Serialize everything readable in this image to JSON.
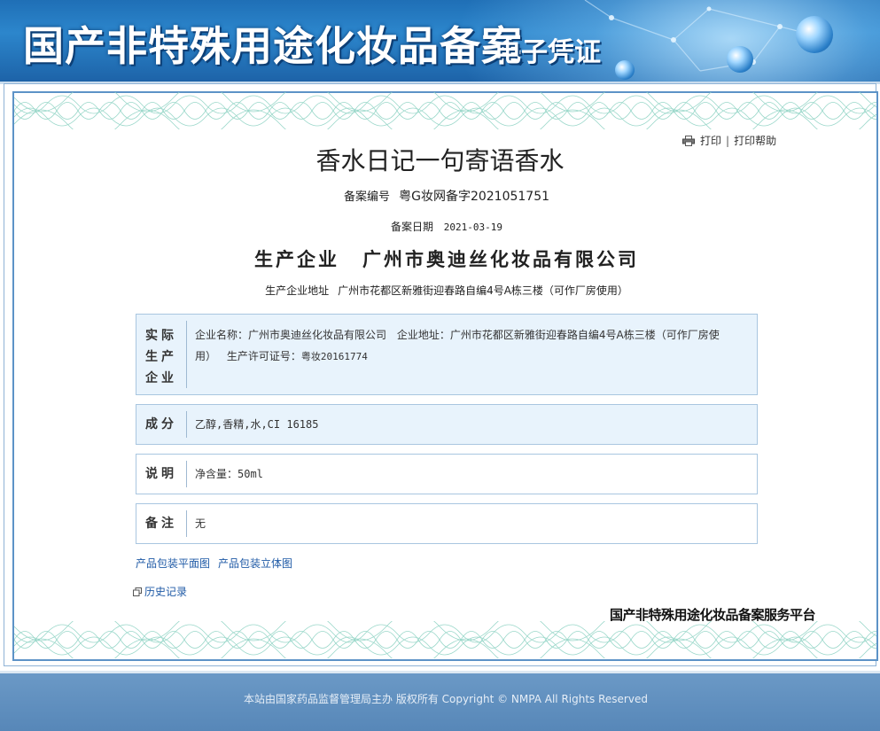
{
  "header": {
    "title": "国产非特殊用途化妆品备案",
    "subtitle": "电子凭证"
  },
  "toolbar": {
    "print_label": "打印",
    "separator": "|",
    "print_help_label": "打印帮助"
  },
  "record": {
    "product_name": "香水日记一句寄语香水",
    "reg_no_label": "备案编号",
    "reg_no": "粤G妆网备字2021051751",
    "reg_date_label": "备案日期",
    "reg_date": "2021-03-19",
    "producer_label": "生产企业",
    "producer_name": "广州市奥迪丝化妆品有限公司",
    "producer_addr_label": "生产企业地址",
    "producer_addr": "广州市花都区新雅街迎春路自编4号A栋三楼（可作厂房使用）"
  },
  "sections": {
    "actual": {
      "label_lines": [
        "实际",
        "生产",
        "企业"
      ],
      "company_label": "企业名称：",
      "company": "广州市奥迪丝化妆品有限公司",
      "address_label": "企业地址：",
      "address": "广州市花都区新雅街迎春路自编4号A栋三楼（可作厂房使用）",
      "license_label": "生产许可证号：",
      "license": "粤妆20161774"
    },
    "ingredients": {
      "label": "成分",
      "value": "乙醇,香精,水,CI 16185"
    },
    "description": {
      "label": "说明",
      "value": "净含量：50ml"
    },
    "remarks": {
      "label": "备注",
      "value": "无"
    }
  },
  "links": {
    "package_flat": "产品包装平面图",
    "package_3d": "产品包装立体图",
    "history": "历史记录"
  },
  "platform_name": "国产非特殊用途化妆品备案服务平台",
  "footer": {
    "text": "本站由国家药品监督管理局主办 版权所有 Copyright © NMPA All Rights Reserved"
  },
  "colors": {
    "banner_blue": "#1f6fb6",
    "frame_blue": "#5d93c7",
    "box_fill": "#e8f3fc",
    "box_border": "#a9c6e0",
    "link_blue": "#1f5aa6",
    "guilloche_green": "#8fd3c4",
    "footer_blue": "#5f8fbf"
  },
  "icons": {
    "print": "printer-icon",
    "history": "window-restore-icon"
  }
}
